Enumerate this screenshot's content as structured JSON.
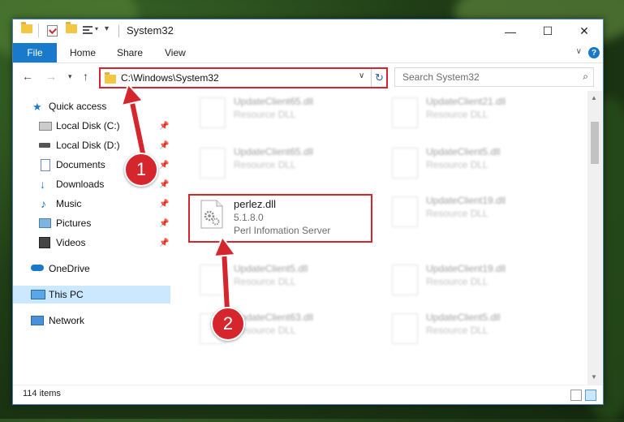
{
  "window": {
    "title": "System32",
    "controls": {
      "minimize": "—",
      "maximize": "☐",
      "close": "✕"
    }
  },
  "ribbon": {
    "tabs": [
      {
        "label": "File"
      },
      {
        "label": "Home"
      },
      {
        "label": "Share"
      },
      {
        "label": "View"
      }
    ],
    "help": "?"
  },
  "address_bar": {
    "path": "C:\\Windows\\System32",
    "search_placeholder": "Search System32"
  },
  "sidebar": {
    "items": [
      {
        "label": "Quick access",
        "icon": "star-icon"
      },
      {
        "label": "Local Disk (C:)",
        "icon": "drive-icon",
        "pinned": true
      },
      {
        "label": "Local Disk (D:)",
        "icon": "drive-icon",
        "pinned": true
      },
      {
        "label": "Documents",
        "icon": "documents-icon",
        "pinned": true
      },
      {
        "label": "Downloads",
        "icon": "downloads-icon",
        "pinned": true
      },
      {
        "label": "Music",
        "icon": "music-icon",
        "pinned": true
      },
      {
        "label": "Pictures",
        "icon": "pictures-icon",
        "pinned": true
      },
      {
        "label": "Videos",
        "icon": "videos-icon",
        "pinned": true
      },
      {
        "label": "OneDrive",
        "icon": "cloud-icon"
      },
      {
        "label": "This PC",
        "icon": "computer-icon",
        "selected": true
      },
      {
        "label": "Network",
        "icon": "network-icon"
      }
    ]
  },
  "files": {
    "left": [
      {
        "name": "UpdateClient65.dll",
        "type": "Resource DLL"
      },
      {
        "name": "UpdateClient65.dll",
        "type": "Resource DLL"
      },
      {
        "name": "perlez.dll",
        "version": "5.1.8.0",
        "description": "Perl Infomation Server"
      },
      {
        "name": "UpdateClient5.dll",
        "type": "Resource DLL"
      },
      {
        "name": "UpdateClient63.dll",
        "type": "Resource DLL"
      }
    ],
    "right": [
      {
        "name": "UpdateClient21.dll",
        "type": "Resource DLL"
      },
      {
        "name": "UpdateClient5.dll",
        "type": "Resource DLL"
      },
      {
        "name": "UpdateClient19.dll",
        "type": "Resource DLL"
      },
      {
        "name": "UpdateClient19.dll",
        "type": "Resource DLL"
      },
      {
        "name": "UpdateClient5.dll",
        "type": "Resource DLL"
      }
    ]
  },
  "status": {
    "items_count": "114 items"
  },
  "callouts": {
    "step1": "1",
    "step2": "2"
  },
  "colors": {
    "accent": "#1979ca",
    "highlight": "#d6262d",
    "selected": "#cce8ff"
  }
}
